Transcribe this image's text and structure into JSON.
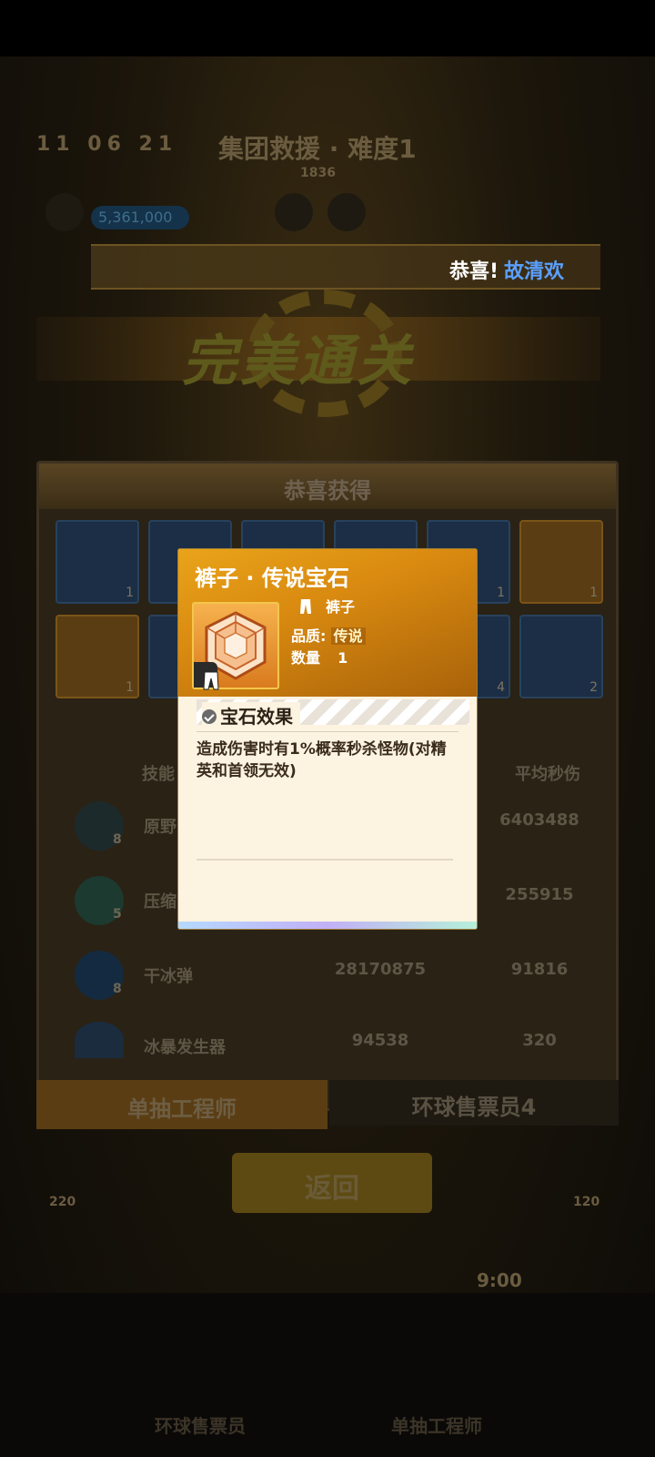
{
  "background": {
    "hud_time": "11  06  21",
    "hud_title": "集团救援 · 难度1",
    "hud_sub": "1836",
    "hud_coin": "5,361,000",
    "perfect_banner": "完美通关",
    "panel_title": "恭喜获得",
    "reward_counts": [
      "1",
      "",
      "",
      "",
      "1",
      "1",
      "1",
      "",
      "",
      "",
      "4",
      "2"
    ],
    "table_headers": [
      "技能",
      "平均秒伤"
    ],
    "rows": [
      {
        "level": "8",
        "name": "原野",
        "total": "",
        "dps": "6403488"
      },
      {
        "level": "5",
        "name": "压缩",
        "total": "",
        "dps": "255915"
      },
      {
        "level": "8",
        "name": "干冰弹",
        "total": "28170875",
        "dps": "91816"
      },
      {
        "level": "",
        "name": "冰暴发生器",
        "total": "94538",
        "dps": "320"
      }
    ],
    "tab_left": "单抽工程师",
    "tab_right": "环球售票员4",
    "back_button": "返回",
    "bottom_left": "环球售票员",
    "bottom_right": "单抽工程师",
    "side_left_value": "220",
    "side_right_value": "120",
    "bottom_timer": "9:00"
  },
  "notification": {
    "prefix": "恭喜!",
    "name": "故清欢"
  },
  "popup": {
    "title": "裤子 · 传说宝石",
    "slot_icon": "pants-icon",
    "slot": "裤子",
    "quality_label": "品质:",
    "quality_value": "传说",
    "quantity_label": "数量",
    "quantity_value": "1",
    "effect_title": "宝石效果",
    "effect_text": "造成伤害时有1%概率秒杀怪物(对精英和首领无效)"
  },
  "colors": {
    "popup_header": "#e9a41a",
    "popup_body": "#fdf3e1",
    "highlight_name": "#5aa0ff"
  }
}
